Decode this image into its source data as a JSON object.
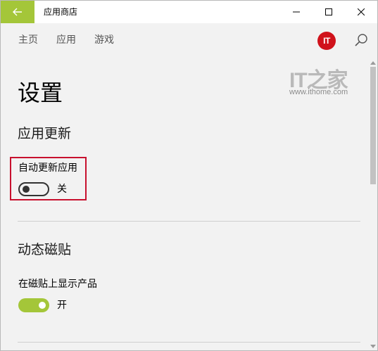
{
  "window": {
    "title": "应用商店"
  },
  "nav": {
    "home": "主页",
    "apps": "应用",
    "games": "游戏",
    "avatar_text": "IT"
  },
  "watermark": {
    "logo_text": "IT之家",
    "url": "www.ithome.com"
  },
  "page": {
    "title": "设置"
  },
  "sections": {
    "app_updates": {
      "title": "应用更新",
      "setting_label": "自动更新应用",
      "toggle_state": "关",
      "toggle_on": false
    },
    "live_tiles": {
      "title": "动态磁贴",
      "setting_label": "在磁贴上显示产品",
      "toggle_state": "开",
      "toggle_on": true
    }
  },
  "icons": {
    "back": "back-arrow-icon",
    "minimize": "minimize-icon",
    "maximize": "maximize-icon",
    "close": "close-icon",
    "search": "search-icon"
  },
  "colors": {
    "accent": "#a4c639",
    "highlight": "#c8102e",
    "avatar": "#d0121b"
  }
}
